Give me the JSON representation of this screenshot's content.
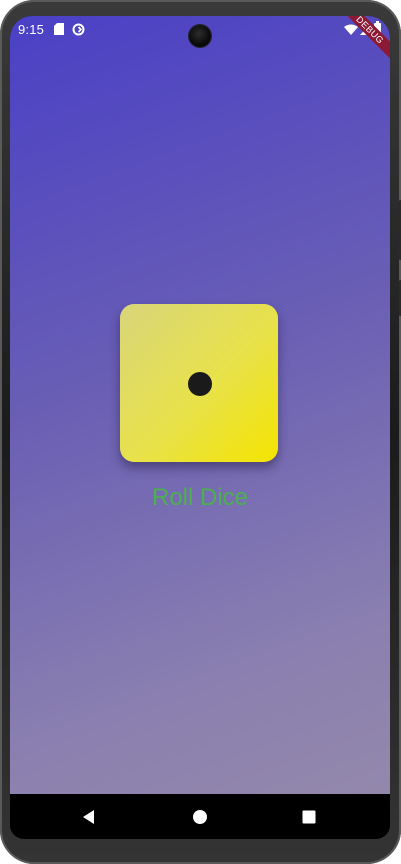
{
  "status_bar": {
    "time": "9:15",
    "icons": [
      "sd-card-icon",
      "sync-icon",
      "wifi-icon",
      "signal-icon",
      "battery-icon"
    ]
  },
  "debug_banner": {
    "label": "DEBUG"
  },
  "dice": {
    "face": 1,
    "color": "#f4e400",
    "pip_color": "#1a1a1a"
  },
  "roll_button": {
    "label": "Roll Dice",
    "color": "#4caf50"
  },
  "navigation": {
    "items": [
      "back-icon",
      "home-icon",
      "recents-icon"
    ]
  },
  "theme": {
    "gradient_start": "#4a40c6",
    "gradient_end": "#9388ab"
  }
}
